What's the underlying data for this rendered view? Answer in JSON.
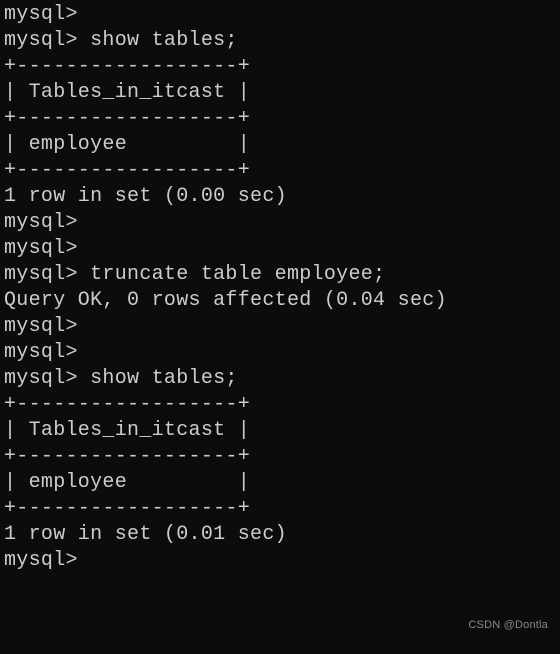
{
  "lines": {
    "l0": "mysql>",
    "l1": "mysql> show tables;",
    "l2": "+------------------+",
    "l3": "| Tables_in_itcast |",
    "l4": "+------------------+",
    "l5": "| employee         |",
    "l6": "+------------------+",
    "l7": "1 row in set (0.00 sec)",
    "l8": "",
    "l9": "mysql>",
    "l10": "mysql>",
    "l11": "mysql> truncate table employee;",
    "l12": "Query OK, 0 rows affected (0.04 sec)",
    "l13": "",
    "l14": "mysql>",
    "l15": "mysql>",
    "l16": "mysql> show tables;",
    "l17": "+------------------+",
    "l18": "| Tables_in_itcast |",
    "l19": "+------------------+",
    "l20": "| employee         |",
    "l21": "+------------------+",
    "l22": "1 row in set (0.01 sec)",
    "l23": "",
    "l24": "mysql>"
  },
  "watermark": "CSDN @Dontla"
}
